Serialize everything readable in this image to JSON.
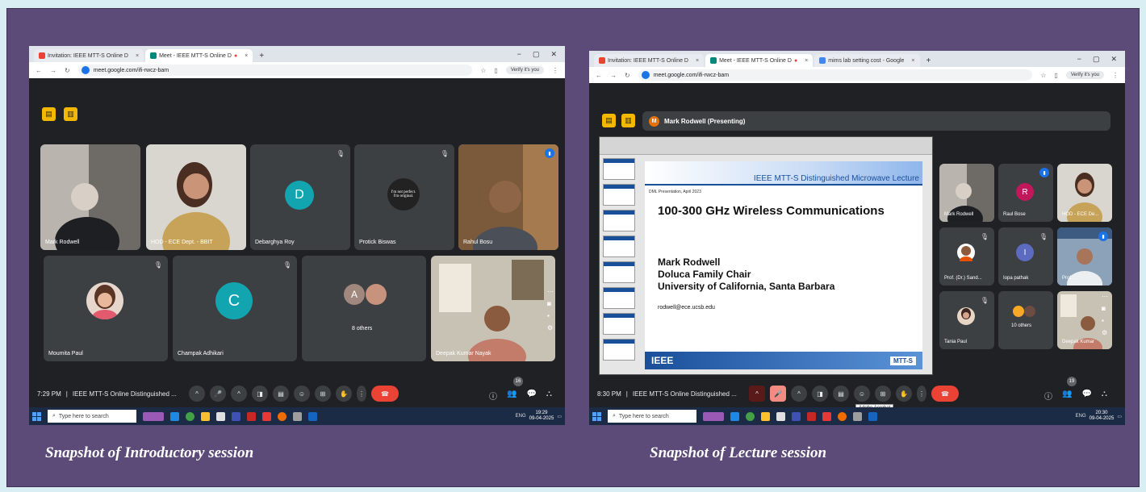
{
  "captions": {
    "intro": "Snapshot of Introductory session",
    "lecture": "Snapshot of Lecture session"
  },
  "colors": {
    "background_frame": "#5c4a78",
    "meet_bg": "#202124",
    "tile_bg": "#3c4043",
    "accent": "#1a73e8",
    "end_call": "#ea4335"
  },
  "shot1": {
    "tabs": [
      "Invitation: IEEE MTT-S Online D",
      "Meet - IEEE MTT-S Online D"
    ],
    "url": "meet.google.com/ifi-rwcz-bam",
    "verify": "Verify it's you",
    "tiles": [
      {
        "name": "Mark Rodwell"
      },
      {
        "name": "HOD - ECE Dept. - BBIT"
      },
      {
        "name": "Debarghya Roy",
        "initial": "D"
      },
      {
        "name": "Protick Biswas",
        "initial": "I'm not perfect. I'm original."
      },
      {
        "name": "Rahul Bosu"
      },
      {
        "name": "Moumita Paul"
      },
      {
        "name": "Champak Adhikari",
        "initial": "C"
      },
      {
        "name": "8 others",
        "initial": "A"
      },
      {
        "name": "Deepak Kumar Nayak"
      }
    ],
    "time": "7:29 PM",
    "meeting": "IEEE MTT-S Online Distinguished ...",
    "participants": "16",
    "search": "Type here to search",
    "lang": "ENG",
    "clock_time": "19:29",
    "clock_date": "09-04-2025"
  },
  "shot2": {
    "tabs": [
      "Invitation: IEEE MTT-S Online D",
      "Meet - IEEE MTT-S Online D",
      "mims lab setting cost - Google"
    ],
    "url": "meet.google.com/ifi-rwcz-bam",
    "verify": "Verify it's you",
    "presenter": "Mark Rodwell (Presenting)",
    "presenter_initial": "M",
    "slide": {
      "header": "IEEE MTT-S Distinguished Microwave Lecture",
      "dml": "DML Presentation, April 2023",
      "title": "100-300 GHz Wireless Communications",
      "author1": "Mark Rodwell",
      "author2": "Doluca Family Chair",
      "author3": "University of California, Santa  Barbara",
      "email": "rodwell@ece.ucsb.edu",
      "footer_left": "IEEE",
      "footer_right": "MTT-S"
    },
    "tiles": [
      {
        "name": "Mark Rodwell"
      },
      {
        "name": "Raul Bose",
        "initial": "R"
      },
      {
        "name": "HOD - ECE De..."
      },
      {
        "name": "Prof. (Dr.) Sand..."
      },
      {
        "name": "Iopa pathak",
        "initial": "I"
      },
      {
        "name": "Prof. ..."
      },
      {
        "name": "Tania Paul"
      },
      {
        "name": "10 others"
      },
      {
        "name": "Deepak Kumar"
      }
    ],
    "time": "8:30 PM",
    "meeting": "IEEE MTT-S Online Distinguished ...",
    "participants": "19",
    "tooltip": "Adobe Acrobat",
    "search": "Type here to search",
    "lang": "ENG",
    "clock_time": "20:30",
    "clock_date": "09-04-2025"
  }
}
